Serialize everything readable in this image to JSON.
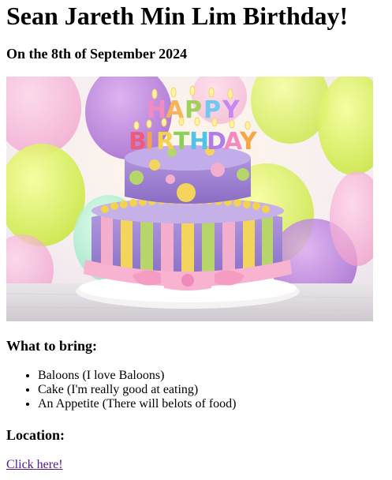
{
  "page": {
    "title": "Sean Jareth Min Lim Birthday!",
    "date": "On the 8th of September 2024"
  },
  "image": {
    "banner_letters": [
      "H",
      "A",
      "P",
      "P",
      "Y"
    ],
    "banner_letters_2": [
      "B",
      "I",
      "R",
      "T",
      "H",
      "D",
      "A",
      "Y"
    ]
  },
  "bring": {
    "heading": "What to bring:",
    "items": [
      "Baloons (I love Baloons)",
      "Cake (I'm really good at eating)",
      "An Appetite (There will belots of food)"
    ]
  },
  "location": {
    "heading": "Location:",
    "link_label": "Click here!"
  },
  "colors": {
    "link_visited": "#551a8b"
  }
}
